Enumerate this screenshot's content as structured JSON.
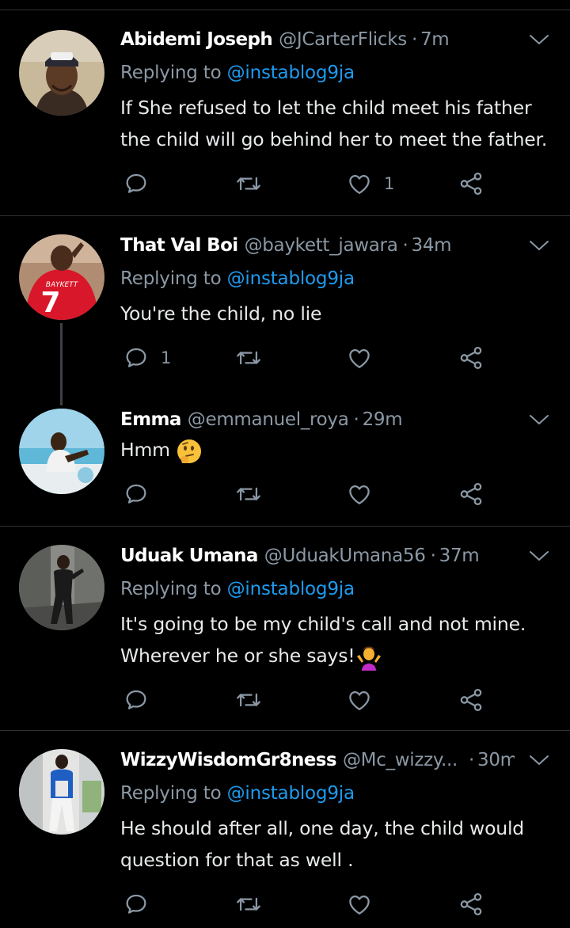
{
  "tweets": [
    {
      "name": "Abidemi Joseph",
      "handle": "@JCarterFlicks",
      "time": "7m",
      "replying_prefix": "Replying to",
      "replying_to": "@instablog9ja",
      "text": "If She refused to let the child meet his father the child will go behind her to meet the father.",
      "reply_count": "",
      "retweet_count": "",
      "like_count": "1"
    },
    {
      "name": "That Val Boi",
      "handle": "@baykett_jawara",
      "time": "34m",
      "replying_prefix": "Replying to",
      "replying_to": "@instablog9ja",
      "text": "You're the child, no lie",
      "reply_count": "1",
      "retweet_count": "",
      "like_count": "",
      "avatar_jersey_text": "BAYKETT",
      "avatar_jersey_number": "7"
    },
    {
      "name": "Emma",
      "handle": "@emmanuel_roya",
      "time": "29m",
      "text": "Hmm",
      "emoji": "thinking-face",
      "reply_count": "",
      "retweet_count": "",
      "like_count": ""
    },
    {
      "name": "Uduak Umana",
      "handle": "@UduakUmana56",
      "time": "37m",
      "replying_prefix": "Replying to",
      "replying_to": "@instablog9ja",
      "text_line1": "It's going to be my child's call and not mine.",
      "text_line2": "Wherever he or she says!",
      "emoji": "person-shrugging",
      "reply_count": "",
      "retweet_count": "",
      "like_count": ""
    },
    {
      "name": "WizzyWisdomGr8ness",
      "handle": "@Mc_wizzy...",
      "time": "30m",
      "replying_prefix": "Replying to",
      "replying_to": "@instablog9ja",
      "text": "He should after all, one day, the child would question for that as well .",
      "reply_count": "",
      "retweet_count": "",
      "like_count": ""
    }
  ],
  "icons": [
    "reply-icon",
    "retweet-icon",
    "like-icon",
    "share-icon",
    "chevron-down-icon"
  ],
  "colors": {
    "background": "#000000",
    "text": "#e7e9ea",
    "secondary": "#8b98a5",
    "link": "#1d9bf0",
    "divider": "#2f3336"
  }
}
